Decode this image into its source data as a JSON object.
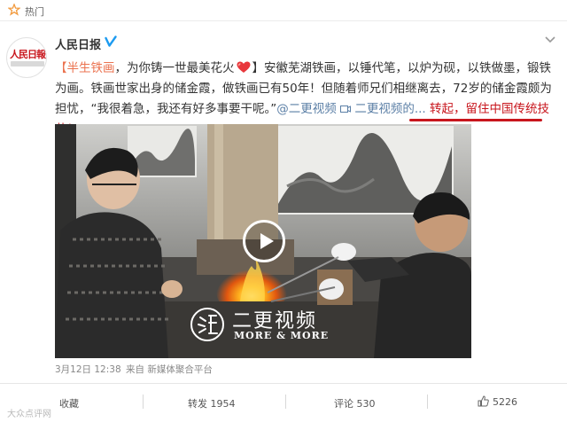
{
  "topbar": {
    "label": "热门"
  },
  "post": {
    "author": "人民日报",
    "avatar_text": "人民日報",
    "text_topic": "【半生铁画",
    "text_part1": "，为你铸一世最美花火",
    "text_part2": "】安徽芜湖铁画，以锤代笔，以炉为砚，以铁做墨，锻铁为画。铁画世家出身的储金霞，做铁画已有50年！但随着师兄们相继离去，72岁的储金霞颇为担忧，“我很着急，我还有好多事要干呢。”",
    "mention": "@二更视频",
    "mention_extra": "二更视频的...",
    "highlight": "转起，留住中国传统技艺！"
  },
  "media": {
    "watermark_title": "二更视频",
    "watermark_sub": "MORE & MORE"
  },
  "meta": {
    "date": "3月12日 12:38",
    "source": "来自 新媒体聚合平台"
  },
  "actions": {
    "favorite": "收藏",
    "repost": "转发 1954",
    "comment": "评论 530",
    "like": "5226"
  },
  "watermark_bottom": "大众点评网",
  "colors": {
    "accent_link": "#eb7350",
    "mention": "#5b7fa6",
    "highlight_red": "#c8161d",
    "verify": "#1d9bf0"
  }
}
